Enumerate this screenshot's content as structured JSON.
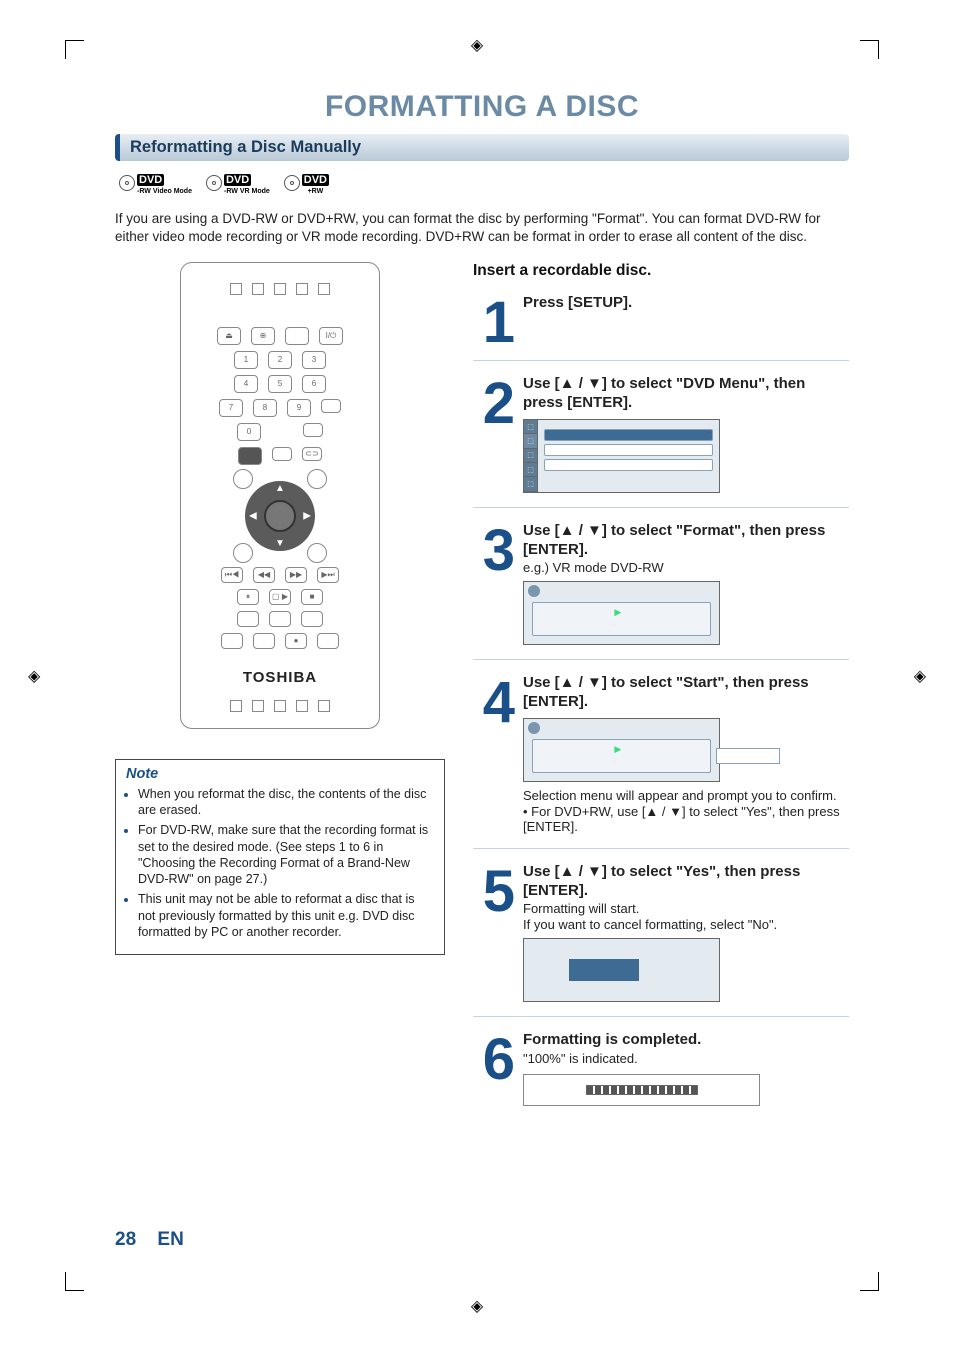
{
  "page": {
    "title": "FORMATTING A DISC",
    "number": "28",
    "lang": "EN"
  },
  "section": {
    "heading": "Reformatting a Disc Manually"
  },
  "badges": [
    {
      "main": "DVD",
      "sub": "-RW",
      "mode": "Video Mode"
    },
    {
      "main": "DVD",
      "sub": "-RW",
      "mode": "VR Mode"
    },
    {
      "main": "DVD",
      "sub": "+RW",
      "mode": ""
    }
  ],
  "intro": "If you are using a DVD-RW or DVD+RW, you can format the disc by performing \"Format\". You can format DVD-RW for either video mode recording or VR mode recording. DVD+RW can be format in order to erase all content of the disc.",
  "remote": {
    "brand": "TOSHIBA"
  },
  "right": {
    "insert": "Insert a recordable disc."
  },
  "steps": [
    {
      "num": "1",
      "title": "Press [SETUP]."
    },
    {
      "num": "2",
      "title": "Use [▲ / ▼] to select \"DVD Menu\", then press [ENTER]."
    },
    {
      "num": "3",
      "title": "Use [▲ / ▼] to select \"Format\", then press [ENTER].",
      "sub": "e.g.) VR mode DVD-RW"
    },
    {
      "num": "4",
      "title": "Use [▲ / ▼] to select \"Start\", then press [ENTER].",
      "after": "Selection menu will appear and prompt you to confirm.",
      "bullet": "For DVD+RW, use [▲ / ▼] to select \"Yes\", then press [ENTER]."
    },
    {
      "num": "5",
      "title": "Use [▲ / ▼] to select \"Yes\", then press [ENTER].",
      "sub": "Formatting will start.",
      "after": "If you want to cancel formatting, select \"No\"."
    },
    {
      "num": "6",
      "title": "Formatting is completed.",
      "sub": "\"100%\" is indicated."
    }
  ],
  "note": {
    "title": "Note",
    "items": [
      "When you reformat the disc, the contents of the disc are erased.",
      "For DVD-RW, make sure that the recording format is set to the desired mode. (See steps 1 to 6 in \"Choosing the Recording Format of a Brand-New DVD-RW\" on page 27.)",
      "This unit may not be able to reformat a disc that is not previously formatted by this unit e.g. DVD disc formatted by PC or another recorder."
    ]
  }
}
